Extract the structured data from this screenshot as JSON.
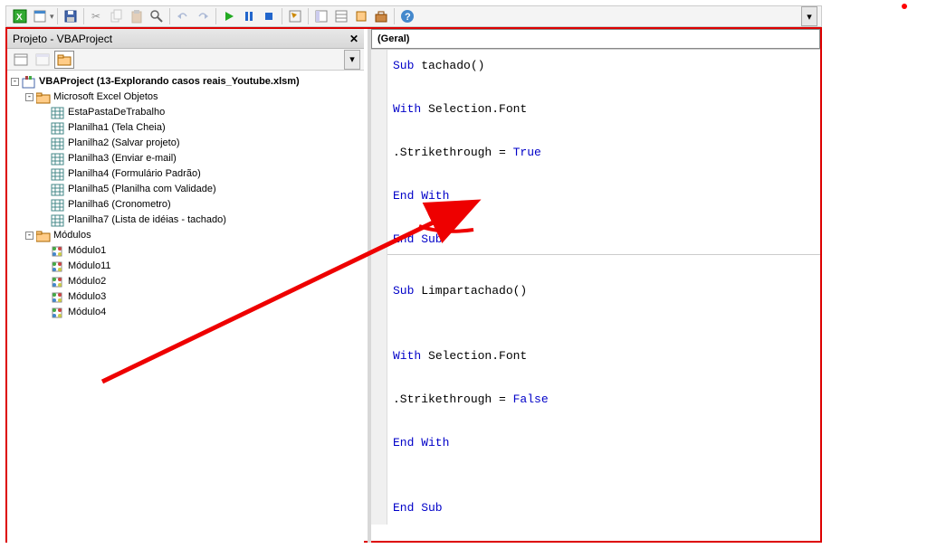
{
  "toolbar": {
    "icons": [
      "excel",
      "form",
      "sep",
      "save",
      "sep",
      "cut",
      "copy",
      "paste",
      "find",
      "sep",
      "undo",
      "redo",
      "sep",
      "run",
      "pause",
      "stop",
      "sep",
      "design",
      "sep",
      "project",
      "props",
      "browser",
      "toolbox",
      "sep",
      "help"
    ]
  },
  "project": {
    "title": "Projeto - VBAProject",
    "root": "VBAProject (13-Explorando casos reais_Youtube.xlsm)",
    "folders": [
      {
        "name": "Microsoft Excel Objetos",
        "items": [
          "EstaPastaDeTrabalho",
          "Planilha1 (Tela Cheia)",
          "Planilha2 (Salvar projeto)",
          "Planilha3 (Enviar e-mail)",
          "Planilha4 (Formulário Padrão)",
          "Planilha5 (Planilha com Validade)",
          "Planilha6 (Cronometro)",
          "Planilha7 (Lista de idéias - tachado)"
        ]
      },
      {
        "name": "Módulos",
        "items": [
          "Módulo1",
          "Módulo11",
          "Módulo2",
          "Módulo3",
          "Módulo4"
        ]
      }
    ]
  },
  "code": {
    "scope": "(Geral)",
    "lines": [
      {
        "t": "Sub",
        "r": " tachado()",
        "k": 1
      },
      {
        "t": "",
        "r": "",
        "k": 0
      },
      {
        "t": "    With",
        "r": " Selection.Font",
        "k": 1
      },
      {
        "t": "",
        "r": "",
        "k": 0
      },
      {
        "t": "        .Strikethrough = ",
        "r": "True",
        "k": 2
      },
      {
        "t": "",
        "r": "",
        "k": 0
      },
      {
        "t": "    End With",
        "r": "",
        "k": 1
      },
      {
        "t": "",
        "r": "",
        "k": 0
      },
      {
        "t": "End Sub",
        "r": "",
        "k": 1
      },
      {
        "hr": true
      },
      {
        "t": "",
        "r": "",
        "k": 0
      },
      {
        "t": "Sub",
        "r": " Limpartachado()",
        "k": 1
      },
      {
        "t": "",
        "r": "",
        "k": 0
      },
      {
        "t": "",
        "r": "",
        "k": 0
      },
      {
        "t": "    With",
        "r": " Selection.Font",
        "k": 1
      },
      {
        "t": "",
        "r": "",
        "k": 0
      },
      {
        "t": "        .Strikethrough = ",
        "r": "False",
        "k": 2
      },
      {
        "t": "",
        "r": "",
        "k": 0
      },
      {
        "t": "    End With",
        "r": "",
        "k": 1
      },
      {
        "t": "",
        "r": "",
        "k": 0
      },
      {
        "t": "",
        "r": "",
        "k": 0
      },
      {
        "t": "End Sub",
        "r": "",
        "k": 1
      }
    ]
  }
}
